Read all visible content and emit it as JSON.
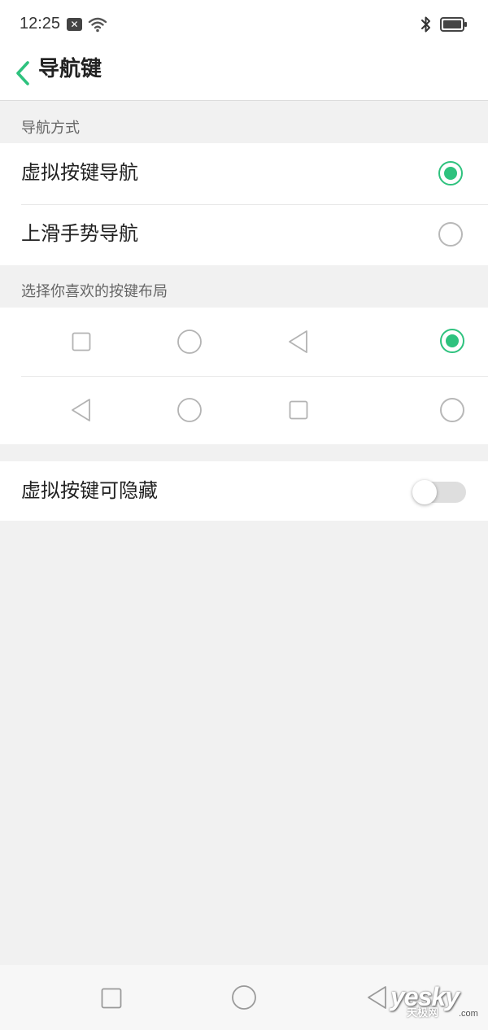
{
  "status_bar": {
    "time": "12:25",
    "notification_icon": "close-box-icon",
    "wifi_icon": "wifi-icon",
    "bluetooth_icon": "bluetooth-icon",
    "battery_icon": "battery-icon"
  },
  "header": {
    "title": "导航键",
    "back_icon": "chevron-left-icon"
  },
  "navigation_mode": {
    "section_label": "导航方式",
    "options": [
      {
        "label": "虚拟按键导航",
        "selected": true
      },
      {
        "label": "上滑手势导航",
        "selected": false
      }
    ]
  },
  "button_layout": {
    "section_label": "选择你喜欢的按键布局",
    "options": [
      {
        "icons": [
          "square-icon",
          "circle-icon",
          "triangle-back-icon"
        ],
        "selected": true
      },
      {
        "icons": [
          "triangle-back-icon",
          "circle-icon",
          "square-icon"
        ],
        "selected": false
      }
    ]
  },
  "hide_keys": {
    "label": "虚拟按键可隐藏",
    "enabled": false
  },
  "nav_bar": {
    "icons": [
      "square-icon",
      "circle-icon",
      "triangle-back-icon"
    ]
  },
  "watermark": {
    "main": "yesky",
    "sub": "天极网",
    "suffix": ".com"
  },
  "colors": {
    "accent": "#2ec27e",
    "background": "#f1f1f1",
    "surface": "#ffffff"
  }
}
